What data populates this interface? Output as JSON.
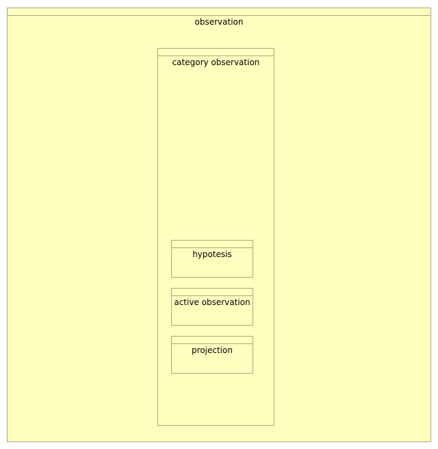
{
  "diagram": {
    "root": {
      "label": "observation"
    },
    "category": {
      "label": "category observation"
    },
    "children": [
      {
        "label": "hypotesis"
      },
      {
        "label": "active observation"
      },
      {
        "label": "projection"
      }
    ],
    "colors": {
      "fill": "#ffffc0",
      "border": "#a8a878"
    }
  }
}
